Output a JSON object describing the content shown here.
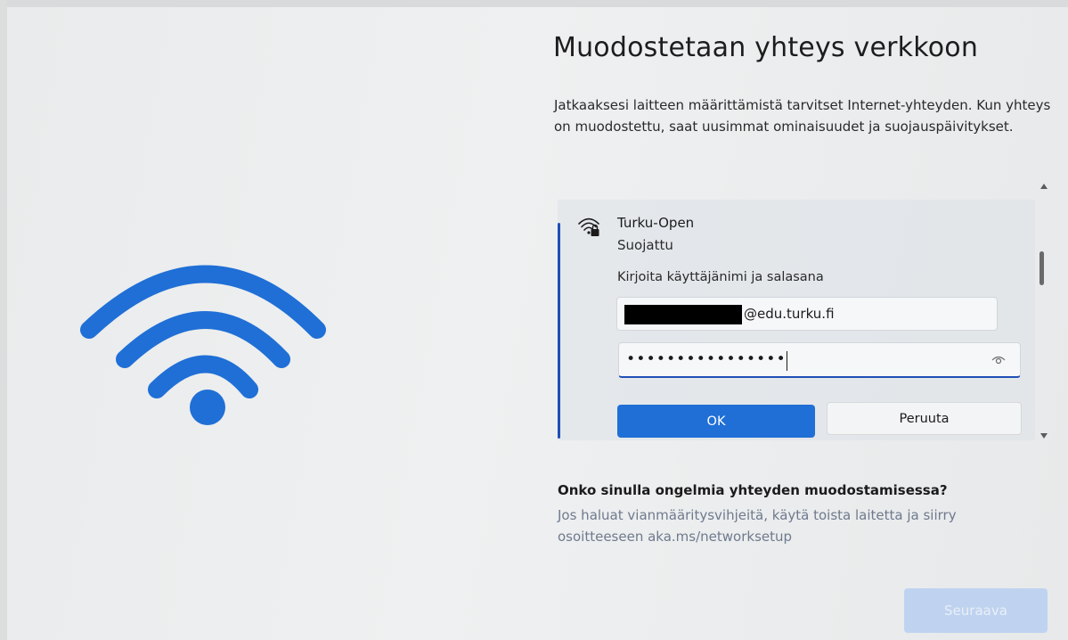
{
  "page": {
    "heading": "Muodostetaan yhteys verkkoon",
    "intro": "Jatkaaksesi laitteen määrittämistä tarvitset Internet-yhteyden. Kun yhteys on muodostettu, saat uusimmat ominaisuudet ja suojauspäivitykset."
  },
  "network": {
    "name": "Turku-Open",
    "status": "Suojattu",
    "credentials_label": "Kirjoita käyttäjänimi ja salasana",
    "username_value": "@edu.turku.fi",
    "password_value": "••••••••••••••••",
    "ok_label": "OK",
    "cancel_label": "Peruuta",
    "icon": "wifi-secured-icon"
  },
  "help": {
    "title": "Onko sinulla ongelmia yhteyden muodostamisessa?",
    "text": "Jos haluat vianmääritysvihjeitä, käytä toista laitetta ja siirry osoitteeseen aka.ms/networksetup"
  },
  "footer": {
    "next_label": "Seuraava"
  },
  "colors": {
    "accent": "#1f6fd6",
    "wifi_illustration": "#1f6fd6",
    "focus_border": "#1f4fb7",
    "next_disabled": "#bfd3f0"
  }
}
